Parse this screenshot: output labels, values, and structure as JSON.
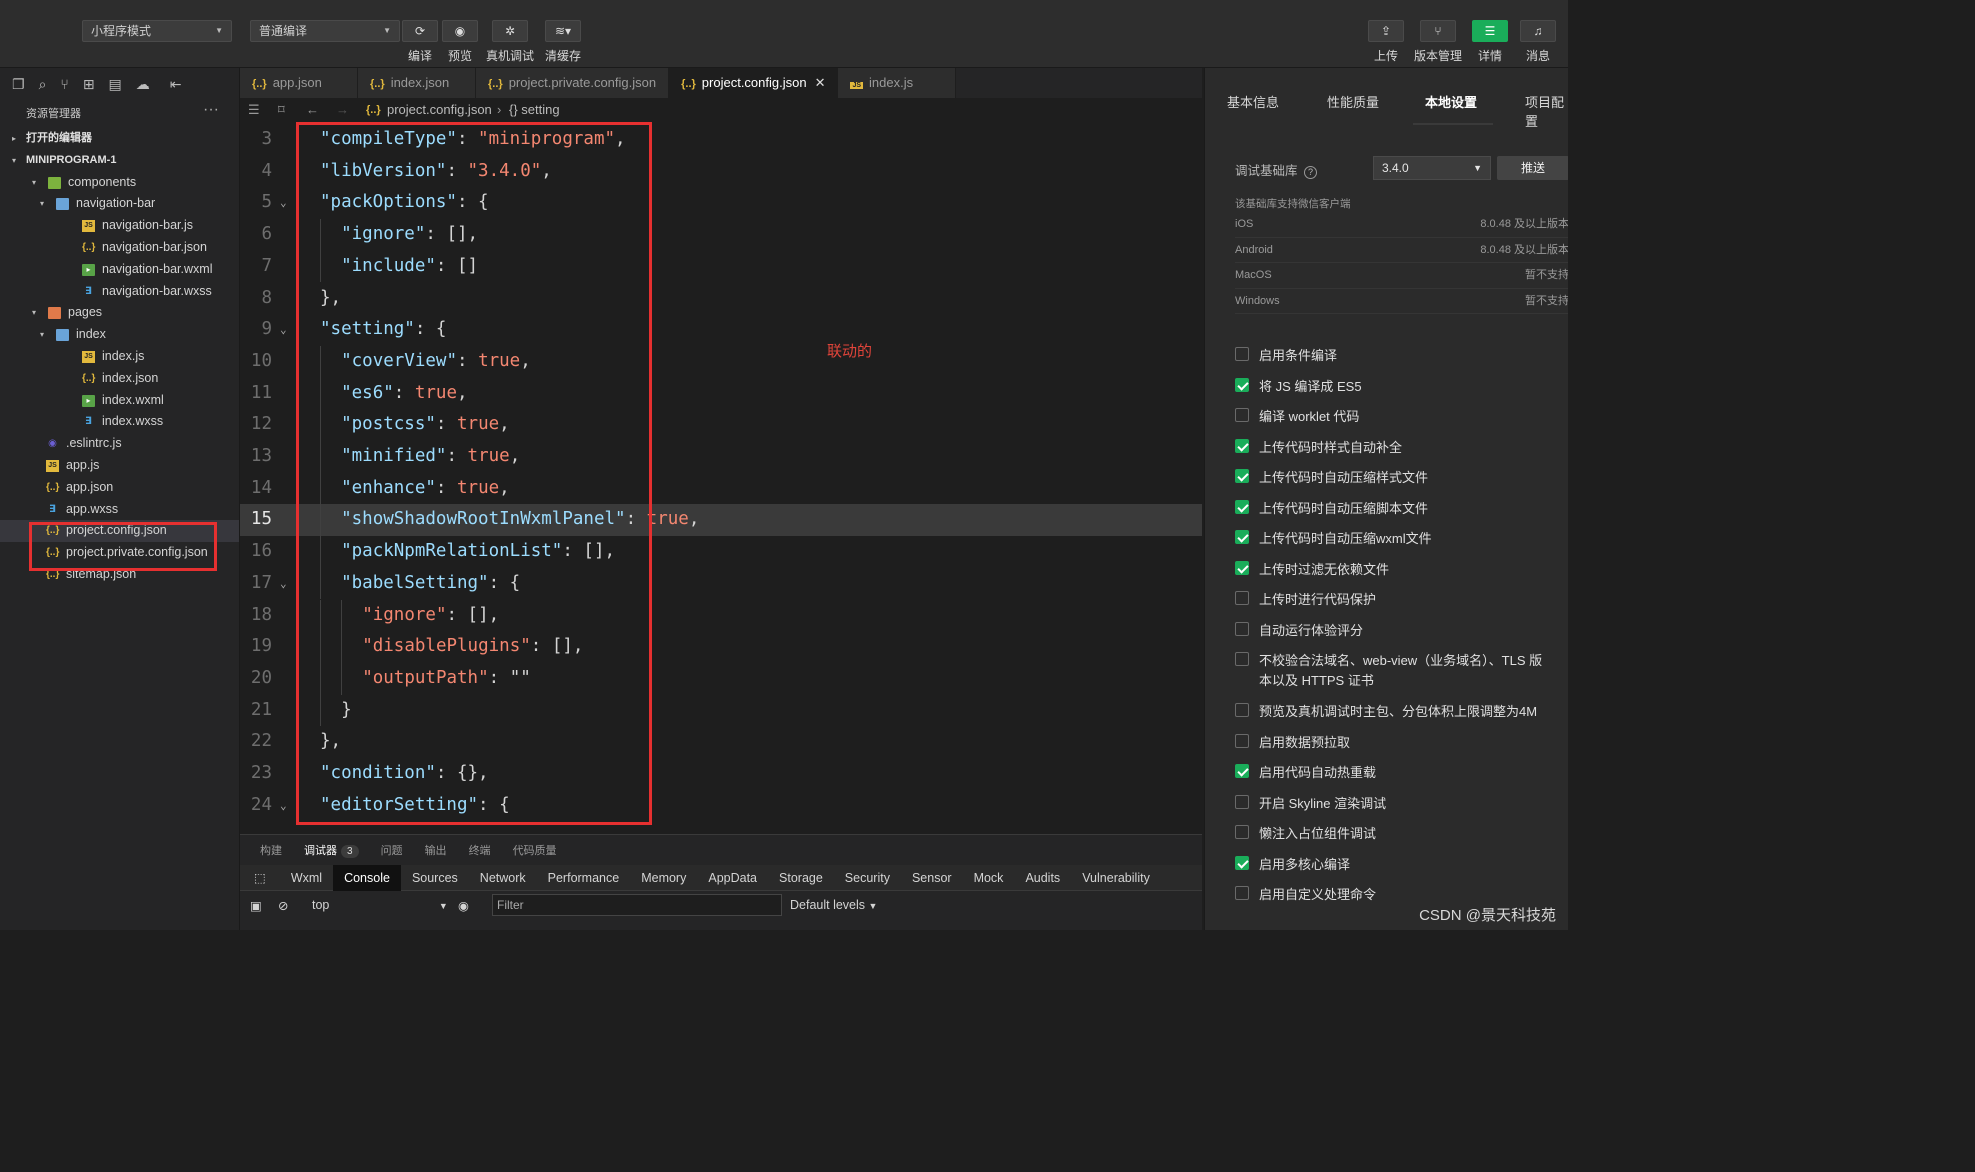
{
  "toolbar": {
    "mode_select": "小程序模式",
    "compile_select": "普通编译",
    "left_buttons": [
      {
        "label": "编译",
        "icon": "refresh-icon"
      },
      {
        "label": "预览",
        "icon": "eye-icon"
      },
      {
        "label": "真机调试",
        "icon": "bug-icon"
      },
      {
        "label": "清缓存",
        "icon": "layers-icon"
      }
    ],
    "right_buttons": [
      {
        "label": "上传",
        "icon": "upload-icon"
      },
      {
        "label": "版本管理",
        "icon": "branch-icon"
      },
      {
        "label": "详情",
        "icon": "menu-icon"
      },
      {
        "label": "消息",
        "icon": "bell-icon"
      }
    ]
  },
  "explorer": {
    "title": "资源管理器",
    "more": "···",
    "open_editors": "打开的编辑器",
    "project": "MINIPROGRAM-1",
    "tree": [
      {
        "label": "components",
        "type": "folder-green",
        "depth": 1,
        "arrow": "▾"
      },
      {
        "label": "navigation-bar",
        "type": "folder-blue",
        "depth": 2,
        "arrow": "▾"
      },
      {
        "label": "navigation-bar.js",
        "type": "js",
        "depth": 3
      },
      {
        "label": "navigation-bar.json",
        "type": "json",
        "depth": 3
      },
      {
        "label": "navigation-bar.wxml",
        "type": "wxml",
        "depth": 3
      },
      {
        "label": "navigation-bar.wxss",
        "type": "wxss",
        "depth": 3
      },
      {
        "label": "pages",
        "type": "folder-red",
        "depth": 1,
        "arrow": "▾"
      },
      {
        "label": "index",
        "type": "folder-blue",
        "depth": 2,
        "arrow": "▾"
      },
      {
        "label": "index.js",
        "type": "js",
        "depth": 3
      },
      {
        "label": "index.json",
        "type": "json",
        "depth": 3
      },
      {
        "label": "index.wxml",
        "type": "wxml",
        "depth": 3
      },
      {
        "label": "index.wxss",
        "type": "wxss",
        "depth": 3
      },
      {
        "label": ".eslintrc.js",
        "type": "eslint",
        "depth": 2
      },
      {
        "label": "app.js",
        "type": "js",
        "depth": 2
      },
      {
        "label": "app.json",
        "type": "json",
        "depth": 2
      },
      {
        "label": "app.wxss",
        "type": "wxss",
        "depth": 2
      },
      {
        "label": "project.config.json",
        "type": "json",
        "depth": 2,
        "selected": true
      },
      {
        "label": "project.private.config.json",
        "type": "json",
        "depth": 2
      },
      {
        "label": "sitemap.json",
        "type": "json",
        "depth": 2
      }
    ]
  },
  "editor": {
    "tabs": [
      {
        "label": "app.json",
        "icon": "{..}"
      },
      {
        "label": "index.json",
        "icon": "{..}"
      },
      {
        "label": "project.private.config.json",
        "icon": "{..}"
      },
      {
        "label": "project.config.json",
        "icon": "{..}",
        "active": true
      },
      {
        "label": "index.js",
        "icon": "JS"
      }
    ],
    "breadcrumb": [
      "project.config.json",
      "{} setting"
    ],
    "annotation": "联动的",
    "current_line": 15,
    "lines": [
      {
        "n": 3,
        "indent": 0,
        "parts": [
          [
            "k",
            "\"compileType\""
          ],
          [
            "p",
            ": "
          ],
          [
            "s",
            "\"miniprogram\""
          ],
          [
            "p",
            ","
          ]
        ]
      },
      {
        "n": 4,
        "indent": 0,
        "parts": [
          [
            "k",
            "\"libVersion\""
          ],
          [
            "p",
            ": "
          ],
          [
            "s",
            "\"3.4.0\""
          ],
          [
            "p",
            ","
          ]
        ]
      },
      {
        "n": 5,
        "indent": 0,
        "fold": true,
        "parts": [
          [
            "k",
            "\"packOptions\""
          ],
          [
            "p",
            ": {"
          ]
        ]
      },
      {
        "n": 6,
        "indent": 1,
        "parts": [
          [
            "k",
            "\"ignore\""
          ],
          [
            "p",
            ": [],"
          ]
        ]
      },
      {
        "n": 7,
        "indent": 1,
        "parts": [
          [
            "k",
            "\"include\""
          ],
          [
            "p",
            ": []"
          ]
        ]
      },
      {
        "n": 8,
        "indent": 0,
        "parts": [
          [
            "p",
            "},"
          ]
        ]
      },
      {
        "n": 9,
        "indent": 0,
        "fold": true,
        "parts": [
          [
            "k",
            "\"setting\""
          ],
          [
            "p",
            ": {"
          ]
        ]
      },
      {
        "n": 10,
        "indent": 1,
        "parts": [
          [
            "k",
            "\"coverView\""
          ],
          [
            "p",
            ": "
          ],
          [
            "b",
            "true"
          ],
          [
            "p",
            ","
          ]
        ]
      },
      {
        "n": 11,
        "indent": 1,
        "parts": [
          [
            "k",
            "\"es6\""
          ],
          [
            "p",
            ": "
          ],
          [
            "b",
            "true"
          ],
          [
            "p",
            ","
          ]
        ]
      },
      {
        "n": 12,
        "indent": 1,
        "parts": [
          [
            "k",
            "\"postcss\""
          ],
          [
            "p",
            ": "
          ],
          [
            "b",
            "true"
          ],
          [
            "p",
            ","
          ]
        ]
      },
      {
        "n": 13,
        "indent": 1,
        "parts": [
          [
            "k",
            "\"minified\""
          ],
          [
            "p",
            ": "
          ],
          [
            "b",
            "true"
          ],
          [
            "p",
            ","
          ]
        ]
      },
      {
        "n": 14,
        "indent": 1,
        "parts": [
          [
            "k",
            "\"enhance\""
          ],
          [
            "p",
            ": "
          ],
          [
            "b",
            "true"
          ],
          [
            "p",
            ","
          ]
        ]
      },
      {
        "n": 15,
        "indent": 1,
        "parts": [
          [
            "k",
            "\"showShadowRootInWxmlPanel\""
          ],
          [
            "p",
            ": "
          ],
          [
            "b",
            "true"
          ],
          [
            "p",
            ","
          ]
        ]
      },
      {
        "n": 16,
        "indent": 1,
        "parts": [
          [
            "k",
            "\"packNpmRelationList\""
          ],
          [
            "p",
            ": [],"
          ]
        ]
      },
      {
        "n": 17,
        "indent": 1,
        "fold": true,
        "parts": [
          [
            "k",
            "\"babelSetting\""
          ],
          [
            "p",
            ": {"
          ]
        ]
      },
      {
        "n": 18,
        "indent": 2,
        "parts": [
          [
            "s",
            "\"ignore\""
          ],
          [
            "p",
            ": [],"
          ]
        ]
      },
      {
        "n": 19,
        "indent": 2,
        "parts": [
          [
            "s",
            "\"disablePlugins\""
          ],
          [
            "p",
            ": [],"
          ]
        ]
      },
      {
        "n": 20,
        "indent": 2,
        "parts": [
          [
            "s",
            "\"outputPath\""
          ],
          [
            "p",
            ": \"\""
          ]
        ]
      },
      {
        "n": 21,
        "indent": 1,
        "parts": [
          [
            "p",
            "}"
          ]
        ]
      },
      {
        "n": 22,
        "indent": 0,
        "parts": [
          [
            "p",
            "},"
          ]
        ]
      },
      {
        "n": 23,
        "indent": 0,
        "parts": [
          [
            "k",
            "\"condition\""
          ],
          [
            "p",
            ": {},"
          ]
        ]
      },
      {
        "n": 24,
        "indent": 0,
        "fold": true,
        "parts": [
          [
            "k",
            "\"editorSetting\""
          ],
          [
            "p",
            ": {"
          ]
        ]
      }
    ]
  },
  "panel": {
    "tabs": [
      "构建",
      "调试器",
      "问题",
      "输出",
      "终端",
      "代码质量"
    ],
    "active_tab": "调试器",
    "badge": "3",
    "devtools_tabs": [
      "Wxml",
      "Console",
      "Sources",
      "Network",
      "Performance",
      "Memory",
      "AppData",
      "Storage",
      "Security",
      "Sensor",
      "Mock",
      "Audits",
      "Vulnerability"
    ],
    "devtools_active": "Console",
    "context": "top",
    "filter_placeholder": "Filter",
    "levels": "Default levels"
  },
  "settings": {
    "tabs": [
      "基本信息",
      "性能质量",
      "本地设置",
      "项目配置"
    ],
    "active_tab": "本地设置",
    "lib_label": "调试基础库",
    "lib_version": "3.4.0",
    "push_button": "推送",
    "support_title": "该基础库支持微信客户端",
    "platforms": [
      {
        "name": "iOS",
        "value": "8.0.48 及以上版本"
      },
      {
        "name": "Android",
        "value": "8.0.48 及以上版本"
      },
      {
        "name": "MacOS",
        "value": "暂不支持"
      },
      {
        "name": "Windows",
        "value": "暂不支持"
      }
    ],
    "options": [
      {
        "label": "启用条件编译",
        "checked": false
      },
      {
        "label": "将 JS 编译成 ES5",
        "checked": true
      },
      {
        "label": "编译 worklet 代码",
        "checked": false
      },
      {
        "label": "上传代码时样式自动补全",
        "checked": true
      },
      {
        "label": "上传代码时自动压缩样式文件",
        "checked": true
      },
      {
        "label": "上传代码时自动压缩脚本文件",
        "checked": true
      },
      {
        "label": "上传代码时自动压缩wxml文件",
        "checked": true
      },
      {
        "label": "上传时过滤无依赖文件",
        "checked": true
      },
      {
        "label": "上传时进行代码保护",
        "checked": false
      },
      {
        "label": "自动运行体验评分",
        "checked": false
      },
      {
        "label": "不校验合法域名、web-view（业务域名）、TLS 版本以及 HTTPS 证书",
        "checked": false
      },
      {
        "label": "预览及真机调试时主包、分包体积上限调整为4M",
        "checked": false
      },
      {
        "label": "启用数据预拉取",
        "checked": false
      },
      {
        "label": "启用代码自动热重载",
        "checked": true
      },
      {
        "label": "开启 Skyline 渲染调试",
        "checked": false
      },
      {
        "label": "懒注入占位组件调试",
        "checked": false
      },
      {
        "label": "启用多核心编译",
        "checked": true
      },
      {
        "label": "启用自定义处理命令",
        "checked": false
      }
    ]
  },
  "watermark": "CSDN @景天科技苑",
  "colors": {
    "accent_green": "#1aad5a",
    "highlight_red": "#e63030",
    "json_key": "#9cdcfe",
    "json_string": "#f48771"
  }
}
